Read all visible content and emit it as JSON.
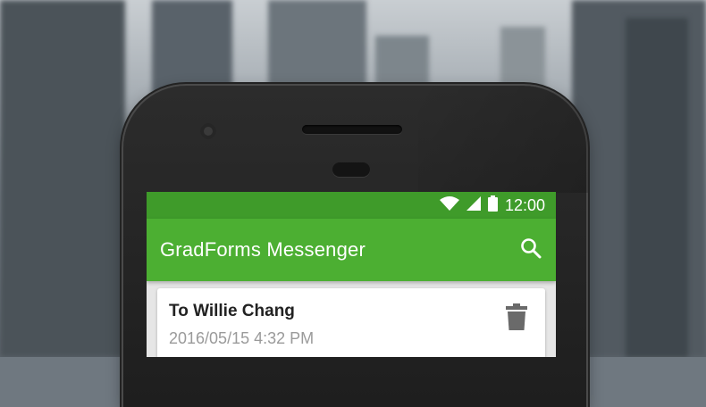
{
  "status_bar": {
    "time": "12:00",
    "icons": [
      "wifi-icon",
      "signal-icon",
      "battery-icon"
    ]
  },
  "app_bar": {
    "title": "GradForms Messenger",
    "action_icon": "search-icon"
  },
  "messages": [
    {
      "recipient": "To Willie Chang",
      "timestamp": "2016/05/15 4:32 PM",
      "action_icon": "trash-icon"
    }
  ],
  "colors": {
    "status_bar": "#3f9b2a",
    "app_bar": "#4caf32",
    "card": "#ffffff",
    "timestamp": "#9a9a9a"
  }
}
